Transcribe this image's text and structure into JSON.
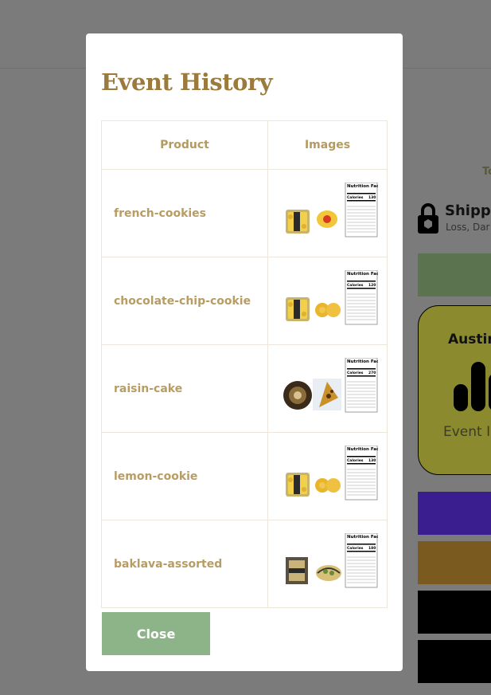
{
  "modal": {
    "title": "Event History",
    "columns": [
      "Product",
      "Images"
    ],
    "rows": [
      {
        "product": "french-cookies",
        "images": [
          "product-package-photo",
          "product-photo",
          "nutrition-facts-label"
        ],
        "calories": "130"
      },
      {
        "product": "chocolate-chip-cookie",
        "images": [
          "product-package-photo",
          "product-photo",
          "nutrition-facts-label"
        ],
        "calories": "120"
      },
      {
        "product": "raisin-cake",
        "images": [
          "product-package-photo",
          "product-photo",
          "nutrition-facts-label"
        ],
        "calories": "270"
      },
      {
        "product": "lemon-cookie",
        "images": [
          "product-package-photo",
          "product-photo",
          "nutrition-facts-label"
        ],
        "calories": "130"
      },
      {
        "product": "baklava-assorted",
        "images": [
          "product-package-photo",
          "product-photo",
          "nutrition-facts-label"
        ],
        "calories": "180"
      }
    ],
    "nutrition_label": "Nutrition Facts",
    "calories_label": "Calories",
    "close_label": "Close"
  },
  "background": {
    "partial_text": "To",
    "shipping_title": "Shipp",
    "shipping_subtitle": "Loss, Dar",
    "card_title": "Austin",
    "card_subtitle": "Event I",
    "button_colors": [
      "#5c7350",
      "#3a1e8f",
      "#7a5a1e",
      "#000000",
      "#000000"
    ],
    "card_color": "#8c8a2e"
  },
  "colors": {
    "accent": "#9a7b3d",
    "close_button": "#8db388",
    "overlay": "#7b7b7b"
  }
}
